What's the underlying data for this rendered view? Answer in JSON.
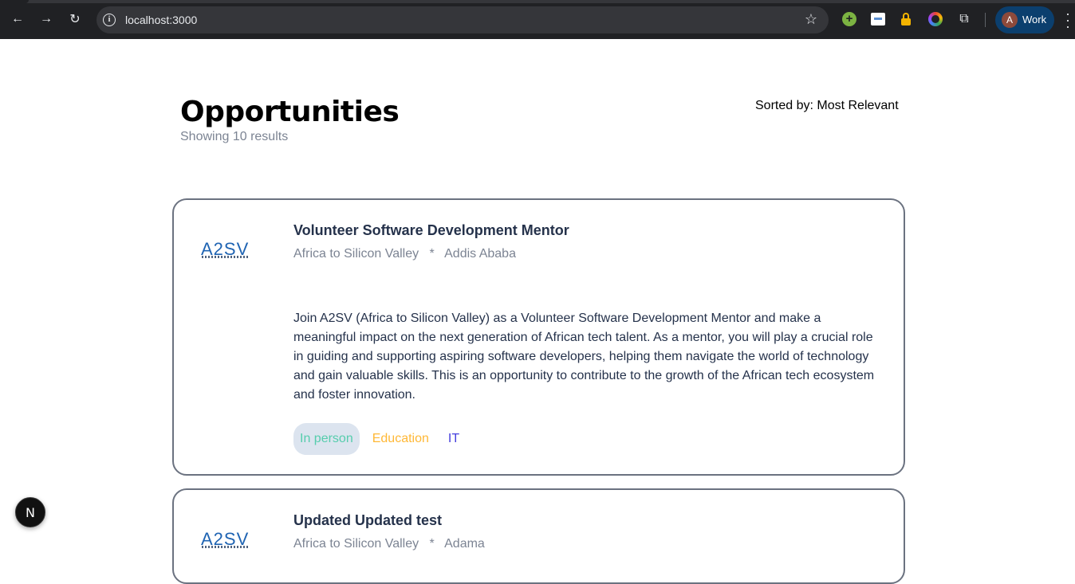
{
  "browser": {
    "url": "localhost:3000",
    "profile_initial": "A",
    "profile_label": "Work",
    "extensions": [
      "green-plus-icon",
      "card-icon",
      "lock-icon",
      "color-ring-icon",
      "puzzle-icon"
    ]
  },
  "header": {
    "title": "Opportunities",
    "result_count": "Showing 10 results",
    "sort_label": "Sorted by: Most Relevant"
  },
  "opportunities": [
    {
      "logo_text": "A2SV",
      "title": "Volunteer Software Development Mentor",
      "meta": "Africa to Silicon Valley   *   Addis Ababa",
      "description": "Join A2SV (Africa to Silicon Valley) as a Volunteer Software Development Mentor and make a meaningful impact on the next generation of African tech talent. As a mentor, you will play a crucial role in guiding and supporting aspiring software developers, helping them navigate the world of technology and gain valuable skills. This is an opportunity to contribute to the growth of the African tech ecosystem and foster innovation.",
      "tags": [
        "In person",
        "Education",
        "IT"
      ]
    },
    {
      "logo_text": "A2SV",
      "title": "Updated Updated test",
      "meta": "Africa to Silicon Valley   *   Adama"
    }
  ],
  "dev_badge": "N",
  "colors": {
    "tag_in_person": "#56cdad",
    "tag_education": "#ffb836",
    "tag_it": "#4640de",
    "title_text": "#25324b",
    "muted_text": "#7c8493"
  }
}
